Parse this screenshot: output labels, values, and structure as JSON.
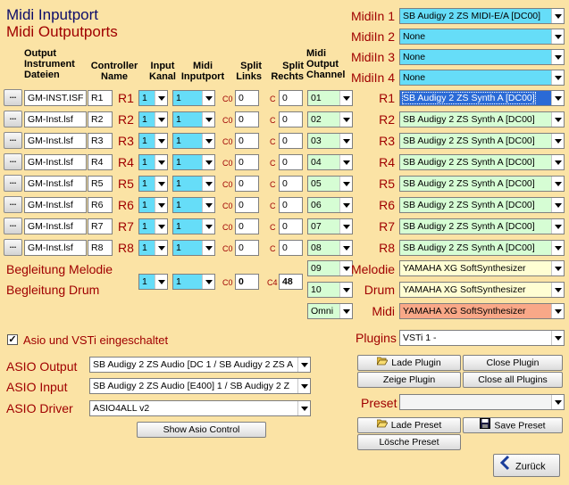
{
  "header": {
    "midi_inputport": "Midi Inputport",
    "midi_outputports": "Midi Outputports"
  },
  "columns": {
    "output": "Output",
    "instrument": "Instrument",
    "dateien": "Dateien",
    "controller": "Controller",
    "name": "Name",
    "input": "Input",
    "kanal": "Kanal",
    "midi": "Midi",
    "inputport": "Inputport",
    "split": "Split",
    "links": "Links",
    "split2": "Split",
    "rechts": "Rechts",
    "midi2": "Midi",
    "output2": "Output",
    "channel": "Channel"
  },
  "rows": [
    {
      "file": "GM-INST.ISF",
      "ctrl": "R1",
      "label": "R1",
      "kanal": "1",
      "inport": "1",
      "cl": "C0",
      "left": "0",
      "cr": "C",
      "right": "0",
      "channel": "01"
    },
    {
      "file": "GM-Inst.lsf",
      "ctrl": "R2",
      "label": "R2",
      "kanal": "1",
      "inport": "1",
      "cl": "C0",
      "left": "0",
      "cr": "C",
      "right": "0",
      "channel": "02"
    },
    {
      "file": "GM-Inst.lsf",
      "ctrl": "R3",
      "label": "R3",
      "kanal": "1",
      "inport": "1",
      "cl": "C0",
      "left": "0",
      "cr": "C",
      "right": "0",
      "channel": "03"
    },
    {
      "file": "GM-Inst.lsf",
      "ctrl": "R4",
      "label": "R4",
      "kanal": "1",
      "inport": "1",
      "cl": "C0",
      "left": "0",
      "cr": "C",
      "right": "0",
      "channel": "04"
    },
    {
      "file": "GM-Inst.lsf",
      "ctrl": "R5",
      "label": "R5",
      "kanal": "1",
      "inport": "1",
      "cl": "C0",
      "left": "0",
      "cr": "C",
      "right": "0",
      "channel": "05"
    },
    {
      "file": "GM-Inst.lsf",
      "ctrl": "R6",
      "label": "R6",
      "kanal": "1",
      "inport": "1",
      "cl": "C0",
      "left": "0",
      "cr": "C",
      "right": "0",
      "channel": "06"
    },
    {
      "file": "GM-Inst.lsf",
      "ctrl": "R7",
      "label": "R7",
      "kanal": "1",
      "inport": "1",
      "cl": "C0",
      "left": "0",
      "cr": "C",
      "right": "0",
      "channel": "07"
    },
    {
      "file": "GM-Inst.lsf",
      "ctrl": "R8",
      "label": "R8",
      "kanal": "1",
      "inport": "1",
      "cl": "C0",
      "left": "0",
      "cr": "C",
      "right": "0",
      "channel": "08"
    }
  ],
  "file_button": "...",
  "accomp": {
    "melodie_label": "Begleitung Melodie",
    "drum_label": "Begleitung Drum",
    "kanal": "1",
    "inport": "1",
    "cl": "C0",
    "left": "0",
    "cr": "C4",
    "right": "48",
    "ch_melodie": "09",
    "ch_drum": "10",
    "ch_omni": "Omni"
  },
  "midi_in": [
    {
      "label": "MidiIn 1",
      "value": "SB Audigy 2 ZS MIDI-E/A [DC00]"
    },
    {
      "label": "MidiIn 2",
      "value": "None"
    },
    {
      "label": "MidiIn 3",
      "value": "None"
    },
    {
      "label": "MidiIn 4",
      "value": "None"
    }
  ],
  "outputs": [
    {
      "label": "R1",
      "value": "SB Audigy 2 ZS Synth A [DC00]"
    },
    {
      "label": "R2",
      "value": "SB Audigy 2 ZS Synth A [DC00]"
    },
    {
      "label": "R3",
      "value": "SB Audigy 2 ZS Synth A [DC00]"
    },
    {
      "label": "R4",
      "value": "SB Audigy 2 ZS Synth A [DC00]"
    },
    {
      "label": "R5",
      "value": "SB Audigy 2 ZS Synth A [DC00]"
    },
    {
      "label": "R6",
      "value": "SB Audigy 2 ZS Synth A [DC00]"
    },
    {
      "label": "R7",
      "value": "SB Audigy 2 ZS Synth A [DC00]"
    },
    {
      "label": "R8",
      "value": "SB Audigy 2 ZS Synth A [DC00]"
    }
  ],
  "special_outputs": [
    {
      "label": "Melodie",
      "value": "YAMAHA XG SoftSynthesizer"
    },
    {
      "label": "Drum",
      "value": "YAMAHA XG SoftSynthesizer"
    },
    {
      "label": "Midi",
      "value": "YAMAHA XG SoftSynthesizer"
    }
  ],
  "asio": {
    "checkbox_label": "Asio und VSTi eingeschaltet",
    "checked": true,
    "output_label": "ASIO Output",
    "output_value": "SB Audigy 2 ZS Audio [DC 1 / SB Audigy 2 ZS A",
    "input_label": "ASIO Input",
    "input_value": "SB Audigy 2 ZS Audio [E400] 1 / SB Audigy 2 Z",
    "driver_label": "ASIO Driver",
    "driver_value": "ASIO4ALL v2",
    "show_control": "Show Asio Control"
  },
  "plugins": {
    "label": "Plugins",
    "value": "VSTi 1 -",
    "lade_plugin": "Lade Plugin",
    "close_plugin": "Close Plugin",
    "zeige_plugin": "Zeige Plugin",
    "close_all": "Close all Plugins"
  },
  "preset": {
    "label": "Preset",
    "value": "",
    "lade_preset": "Lade Preset",
    "save_preset": "Save Preset",
    "loesche_preset": "Lösche Preset"
  },
  "back_button": "Zurück",
  "colors": {
    "background": "#fbe3a5",
    "label_red": "#a00000",
    "cyan": "#66ddf8",
    "green": "#d6fdd4",
    "selection": "#2a6ad6",
    "salmon": "#f9a888"
  }
}
